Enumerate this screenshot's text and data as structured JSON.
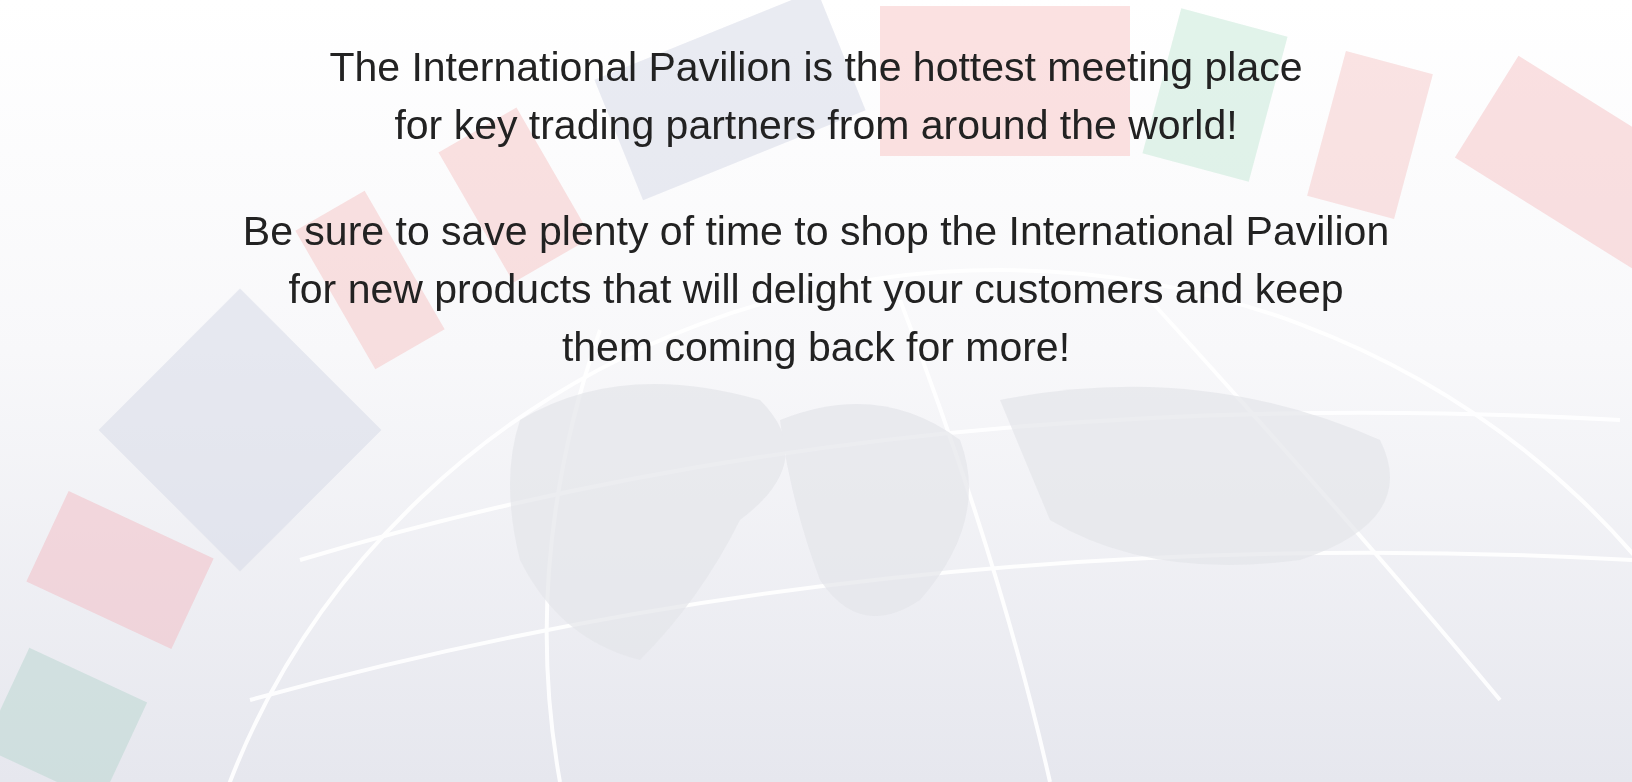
{
  "paragraphs": [
    {
      "lines": [
        "The International Pavilion is the hottest meeting place",
        "for key trading partners from around the world!"
      ]
    },
    {
      "lines": [
        "Be sure to save plenty of time to shop the International Pavilion",
        "for new products that will delight your customers and keep",
        "them coming back for more!"
      ]
    }
  ]
}
